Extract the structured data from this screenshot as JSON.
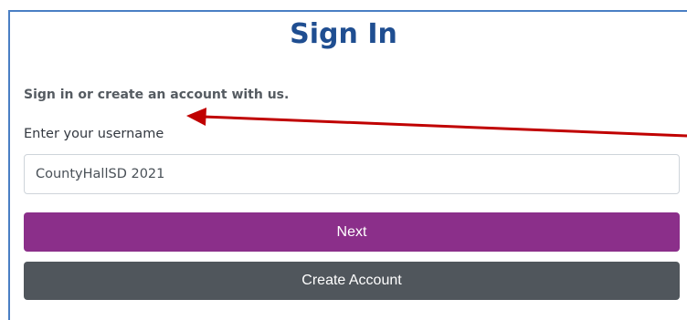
{
  "form": {
    "title": "Sign In",
    "subtitle": "Sign in or create an account with us.",
    "username_label": "Enter your username",
    "username_value": "CountyHallSD 2021",
    "next_label": "Next",
    "create_account_label": "Create Account"
  },
  "colors": {
    "title": "#1f4e91",
    "next_button": "#8b2f8a",
    "create_button": "#50565c",
    "annotation_arrow": "#c00000",
    "frame_border": "#4a7fc4"
  },
  "annotation": {
    "icon": "arrow-left-icon"
  }
}
